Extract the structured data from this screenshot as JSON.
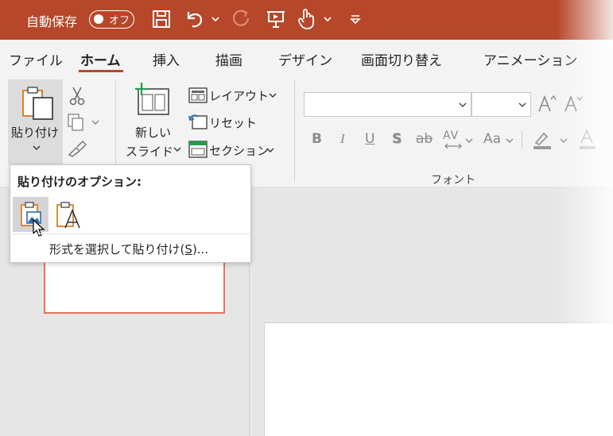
{
  "titlebar": {
    "autosave_label": "自動保存",
    "autosave_state": "オフ",
    "bg_color": "#b7472a",
    "icons": [
      "save-icon",
      "undo-icon",
      "chevron-down-icon",
      "redo-icon",
      "present-icon",
      "touch-mode-icon",
      "chevron-down-icon",
      "customize-icon"
    ]
  },
  "tabs": [
    {
      "label": "ファイル"
    },
    {
      "label": "ホーム",
      "active": true
    },
    {
      "label": "挿入"
    },
    {
      "label": "描画"
    },
    {
      "label": "デザイン"
    },
    {
      "label": "画面切り替え"
    },
    {
      "label": "アニメーション"
    }
  ],
  "ribbon": {
    "clipboard": {
      "paste_label": "貼り付け",
      "icons": [
        "paste-icon",
        "cut-icon",
        "copy-icon",
        "format-painter-icon"
      ]
    },
    "slides": {
      "new_slide_line1": "新しい",
      "new_slide_line2": "スライド",
      "layout_label": "レイアウト",
      "reset_label": "リセット",
      "section_label": "セクション"
    },
    "font": {
      "group_label": "フォント",
      "font_name_value": "",
      "font_size_value": "",
      "bold": "B",
      "italic": "I",
      "underline": "U",
      "shadow": "S",
      "strike": "ab",
      "spacing": "AV",
      "case": "Aa"
    }
  },
  "paste_dropdown": {
    "title": "貼り付けのオプション:",
    "option_icons": [
      "paste-picture-icon",
      "paste-text-only-icon"
    ],
    "special_pre": "形式を選択して貼り付け(",
    "special_key": "S",
    "special_post": ")..."
  }
}
